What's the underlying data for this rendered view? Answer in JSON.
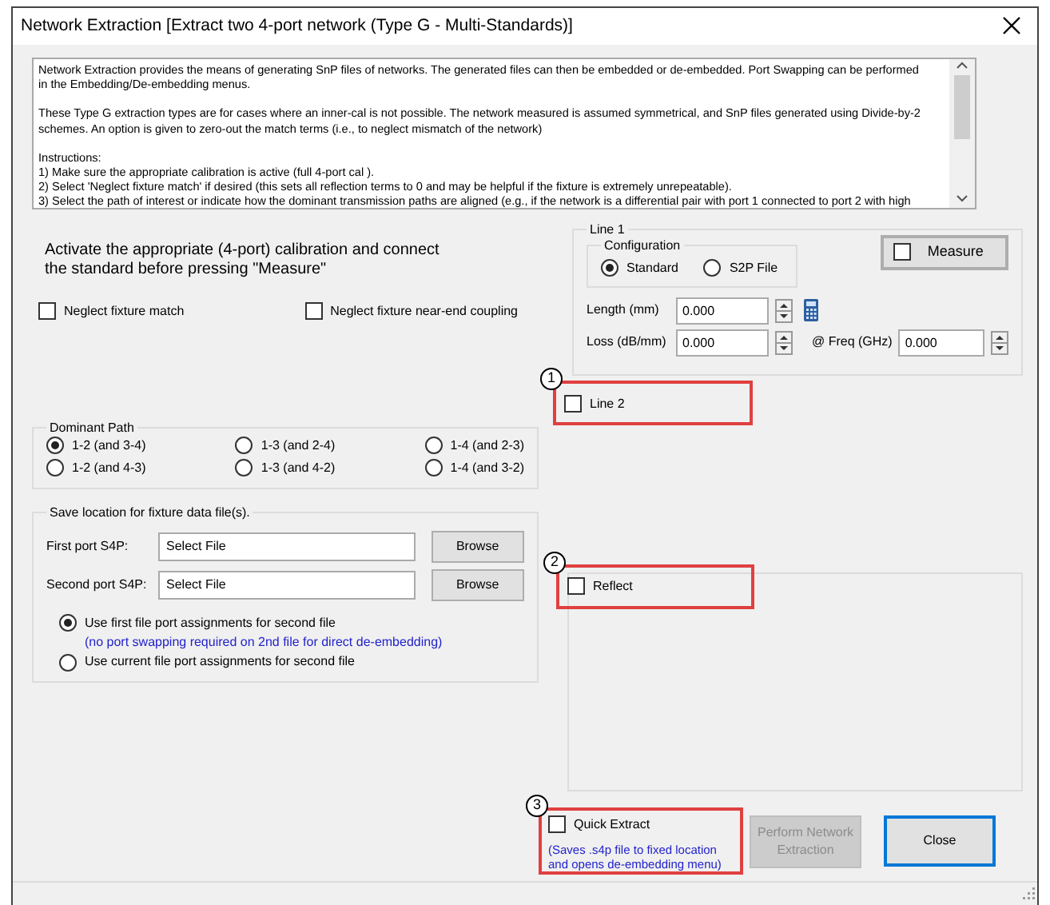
{
  "window": {
    "title": "Network Extraction [Extract two 4-port network (Type G - Multi-Standards)]"
  },
  "info_text": {
    "paragraphs": [
      [
        "Network Extraction provides the means of generating SnP files of networks. The generated files can then be embedded or de-embedded. Port Swapping can be performed",
        "in the Embedding/De-embedding menus."
      ],
      [
        "These Type G extraction types are for cases where an inner-cal is not possible. The network measured is assumed symmetrical, and SnP files generated using Divide-by-2",
        "schemes. An option is given to zero-out the match terms (i.e., to neglect mismatch of the network)"
      ],
      [
        "Instructions:",
        "1) Make sure the appropriate calibration is active (full 4-port cal ).",
        "2) Select 'Neglect fixture match' if desired (this sets all reflection terms to 0 and may be helpful if the fixture is extremely unrepeatable).",
        "3) Select the path of interest or indicate how the dominant transmission paths are aligned (e.g., if the network is a differential pair with port 1 connected to port 2 with high"
      ]
    ]
  },
  "instruction": "Activate the appropriate (4-port) calibration and connect the standard before pressing \"Measure\"",
  "options": [
    {
      "label": "Neglect fixture match",
      "checked": false
    },
    {
      "label": "Neglect fixture near-end coupling",
      "checked": false
    }
  ],
  "dominant_path": {
    "title": "Dominant Path",
    "options": [
      {
        "label": "1-2 (and 3-4)",
        "selected": true
      },
      {
        "label": "1-3 (and 2-4)",
        "selected": false
      },
      {
        "label": "1-4 (and 2-3)",
        "selected": false
      },
      {
        "label": "1-2 (and 4-3)",
        "selected": false
      },
      {
        "label": "1-3 (and 4-2)",
        "selected": false
      },
      {
        "label": "1-4 (and 3-2)",
        "selected": false
      }
    ]
  },
  "save_location": {
    "title": "Save location for fixture data file(s).",
    "files": [
      {
        "label": "First port S4P:",
        "value": "Select File",
        "button": "Browse"
      },
      {
        "label": "Second port S4P:",
        "value": "Select File",
        "button": "Browse"
      }
    ],
    "assignments": [
      {
        "label": "Use first file port assignments for second file",
        "note": "(no port swapping required on 2nd file for direct de-embedding)",
        "selected": true
      },
      {
        "label": "Use current file port assignments for second file",
        "selected": false
      }
    ]
  },
  "line1": {
    "title": "Line 1",
    "configuration": {
      "title": "Configuration",
      "options": [
        {
          "label": "Standard",
          "selected": true
        },
        {
          "label": "S2P File",
          "selected": false
        }
      ]
    },
    "measure": {
      "label": "Measure",
      "checked": false
    },
    "length": {
      "label": "Length (mm)",
      "value": "0.000"
    },
    "loss": {
      "label": "Loss (dB/mm)",
      "value": "0.000"
    },
    "freq": {
      "label": "@ Freq (GHz)",
      "value": "0.000"
    }
  },
  "line2": {
    "label": "Line 2",
    "checked": false,
    "callout": "1"
  },
  "reflect": {
    "label": "Reflect",
    "checked": false,
    "callout": "2"
  },
  "quick_extract": {
    "label": "Quick Extract",
    "checked": false,
    "note": "(Saves .s4p file to fixed location and opens de-embedding menu)",
    "callout": "3"
  },
  "buttons": {
    "perform": {
      "label": "Perform Network Extraction",
      "disabled": true
    },
    "close": {
      "label": "Close",
      "disabled": false
    }
  }
}
